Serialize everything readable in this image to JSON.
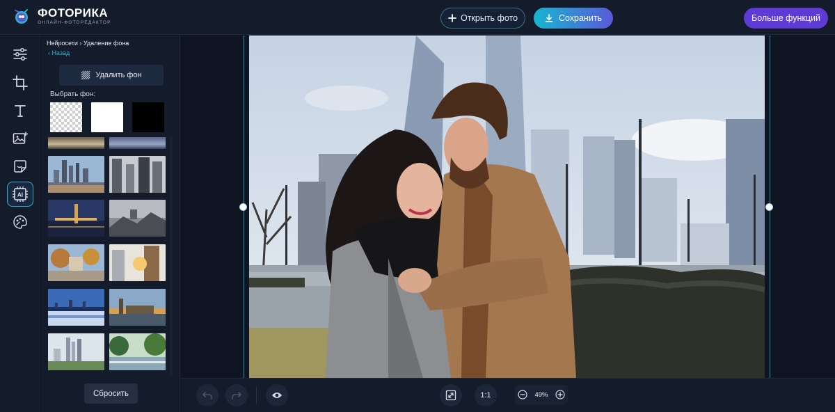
{
  "app": {
    "title": "ФОТОРИКА",
    "subtitle": "ОНЛАЙН-ФОТОРЕДАКТОР"
  },
  "header": {
    "open_label": "Открыть фото",
    "save_label": "Сохранить",
    "more_label": "Больше функций"
  },
  "toolbar": {
    "tools": [
      {
        "name": "adjust",
        "icon": "sliders-icon"
      },
      {
        "name": "crop",
        "icon": "crop-icon"
      },
      {
        "name": "text",
        "icon": "text-icon"
      },
      {
        "name": "image",
        "icon": "image-add-icon"
      },
      {
        "name": "stickers",
        "icon": "sticker-icon"
      },
      {
        "name": "ai",
        "icon": "ai-chip-icon",
        "label": "AI",
        "active": true
      },
      {
        "name": "effects",
        "icon": "palette-icon"
      }
    ]
  },
  "panel": {
    "breadcrumb": "Нейросети › Удаление фона",
    "back_label": "‹ Назад",
    "remove_bg_label": "Удалить фон",
    "choose_bg_label": "Выбрать фон:",
    "swatches": [
      "transparent",
      "#ffffff",
      "#000000"
    ],
    "reset_label": "Сбросить"
  },
  "canvas": {
    "zoom": "49%",
    "ratio_label": "1:1"
  },
  "colors": {
    "accent": "#2fb5c9",
    "save_gradient_start": "#17b6d0",
    "save_gradient_end": "#5b59d8",
    "more_button": "#5f3bd6",
    "panel_bg": "#141b2b",
    "app_bg": "#0e1422"
  }
}
